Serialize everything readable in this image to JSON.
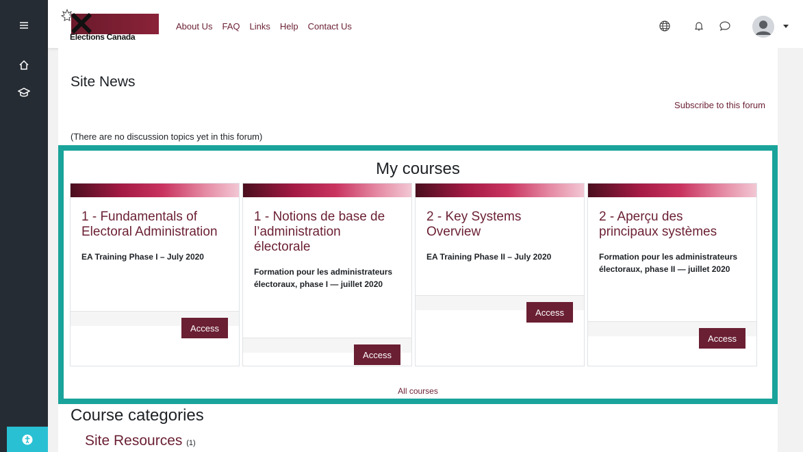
{
  "nav": {
    "logo_text": "Elections Canada",
    "links": [
      "About Us",
      "FAQ",
      "Links",
      "Help",
      "Contact Us"
    ]
  },
  "site_news": {
    "title": "Site News",
    "subscribe": "Subscribe to this forum",
    "empty": "(There are no discussion topics yet in this forum)"
  },
  "my_courses": {
    "title": "My courses",
    "cards": [
      {
        "title": "1 - Fundamentals of Electoral Administration",
        "subtitle": "EA Training Phase I – July 2020",
        "button": "Access"
      },
      {
        "title": "1 - Notions de base de l’administration électorale",
        "subtitle": "Formation pour les administrateurs électoraux, phase I — juillet 2020",
        "button": "Access"
      },
      {
        "title": "2 - Key Systems Overview",
        "subtitle": "EA Training Phase II – July 2020",
        "button": "Access"
      },
      {
        "title": "2 - Aperçu des principaux systèmes",
        "subtitle": "Formation pour les administrateurs électoraux, phase II — juillet 2020",
        "button": "Access"
      }
    ],
    "all_courses": "All courses"
  },
  "categories": {
    "title": "Course categories",
    "items": [
      {
        "name": "Site Resources",
        "count": "(1)"
      }
    ]
  },
  "colors": {
    "brand": "#6a1f33",
    "highlight": "#1aa39a",
    "rail": "#262c33"
  }
}
